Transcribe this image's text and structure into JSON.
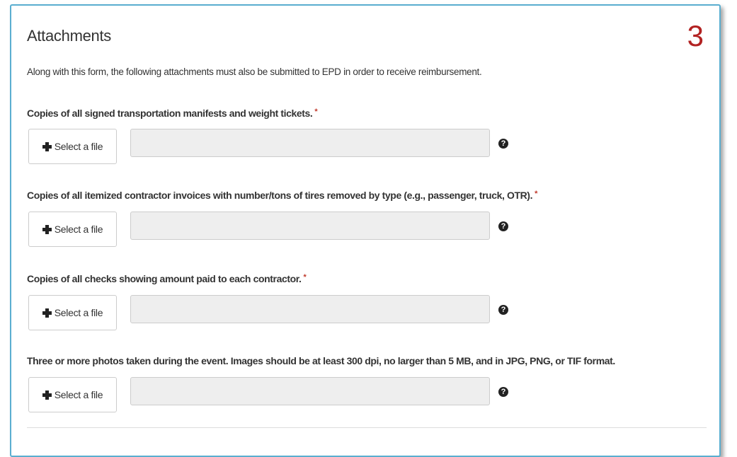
{
  "step_number": "3",
  "section": {
    "title": "Attachments",
    "intro": "Along with this form, the following attachments must also be submitted to EPD in order to receive reimbursement."
  },
  "required_marker": "*",
  "fields": [
    {
      "label": "Copies of all signed transportation manifests and weight tickets.",
      "required": true,
      "button_label": "Select a file",
      "value": ""
    },
    {
      "label": "Copies of all itemized contractor invoices with number/tons of tires removed by type (e.g., passenger, truck, OTR).",
      "required": true,
      "button_label": "Select a file",
      "value": ""
    },
    {
      "label": "Copies of all checks showing amount paid to each contractor.",
      "required": true,
      "button_label": "Select a file",
      "value": ""
    },
    {
      "label": "Three or more photos taken during the event. Images should be at least 300 dpi, no larger than 5 MB, and in JPG, PNG, or TIF format.",
      "required": false,
      "button_label": "Select a file",
      "value": ""
    }
  ],
  "icons": {
    "button_icon": "plus-icon",
    "help_icon": "question-circle-icon",
    "help_glyph": "?"
  },
  "colors": {
    "panel_border": "#5aaed0",
    "step_number": "#b22222",
    "required": "#c0392b",
    "input_bg": "#eeeeee"
  }
}
